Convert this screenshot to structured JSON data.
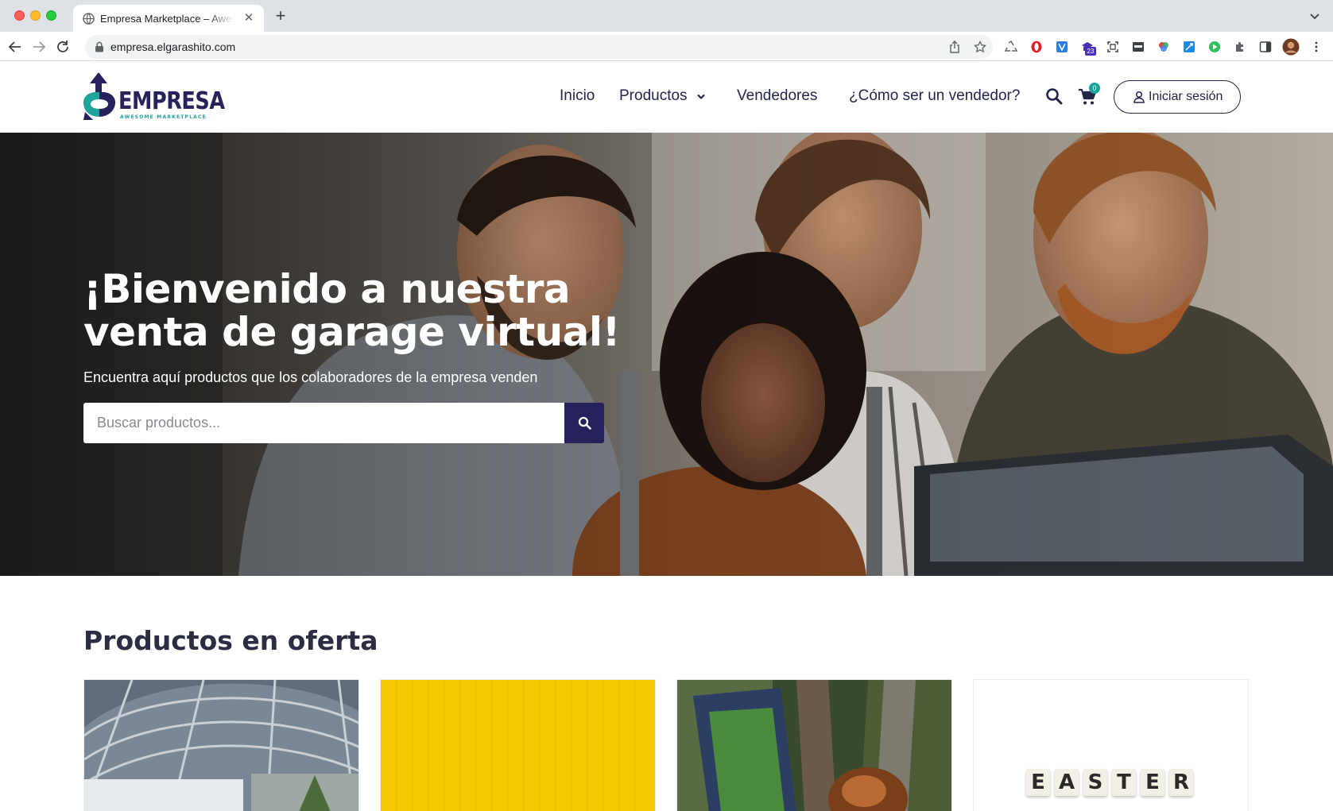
{
  "browser": {
    "tab_title": "Empresa Marketplace – Awesome Marketplace",
    "url": "empresa.elgarashito.com",
    "extension_badge": "23",
    "icons": [
      "back-icon",
      "forward-icon",
      "reload-icon",
      "lock-icon",
      "share-icon",
      "star-icon",
      "extensions-icon",
      "sidebar-icon",
      "profile-avatar",
      "menu-icon"
    ]
  },
  "header": {
    "logo_text": "EMPRESA",
    "logo_tagline": "AWESOME MARKETPLACE",
    "nav": {
      "inicio": "Inicio",
      "productos": "Productos",
      "vendedores": "Vendedores",
      "como": "¿Cómo ser un vendedor?"
    },
    "cart_count": "0",
    "login_label": "Iniciar sesión"
  },
  "hero": {
    "title": "¡Bienvenido a nuestra venta de garage virtual!",
    "subtitle": "Encuentra aquí productos que los colaboradores de la empresa venden",
    "search_placeholder": "Buscar productos..."
  },
  "offers": {
    "title": "Productos en oferta",
    "cards": [
      {
        "image": "greenhouse-photo"
      },
      {
        "image": "yellow-paper-photo"
      },
      {
        "image": "shoe-photo"
      },
      {
        "image": "easter-tiles-photo",
        "tiles": [
          "E",
          "A",
          "S",
          "T",
          "E",
          "R"
        ]
      }
    ]
  },
  "colors": {
    "brand_navy": "#25225c",
    "brand_teal": "#13a59c",
    "nav_text": "#23264a"
  }
}
